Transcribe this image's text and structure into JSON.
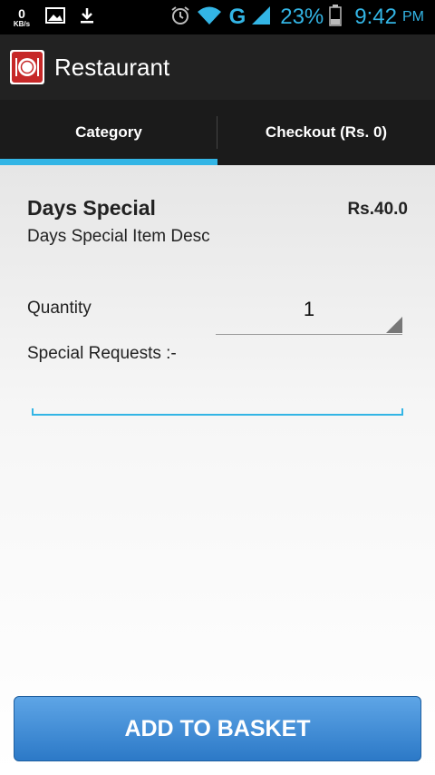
{
  "status_bar": {
    "data_rate": "0",
    "data_unit": "KB/s",
    "network": "G",
    "battery": "23%",
    "time": "9:42",
    "ampm": "PM",
    "icons": [
      "image-icon",
      "download-icon",
      "alarm-icon",
      "wifi-icon",
      "signal-icon",
      "battery-icon"
    ]
  },
  "action_bar": {
    "title": "Restaurant",
    "icon": "restaurant-plate-icon"
  },
  "tabs": [
    {
      "label": "Category",
      "selected": true
    },
    {
      "label": "Checkout (Rs. 0)",
      "selected": false
    }
  ],
  "item": {
    "name": "Days Special",
    "price": "Rs.40.0",
    "description": "Days Special Item Desc"
  },
  "form": {
    "quantity_label": "Quantity",
    "quantity_value": "1",
    "special_requests_label": "Special Requests :-",
    "special_requests_value": ""
  },
  "add_button_label": "ADD TO BASKET",
  "colors": {
    "accent": "#33b5e5",
    "button": "#3d8ad6",
    "actionbar": "#222222",
    "tabs": "#1b1b1b"
  }
}
